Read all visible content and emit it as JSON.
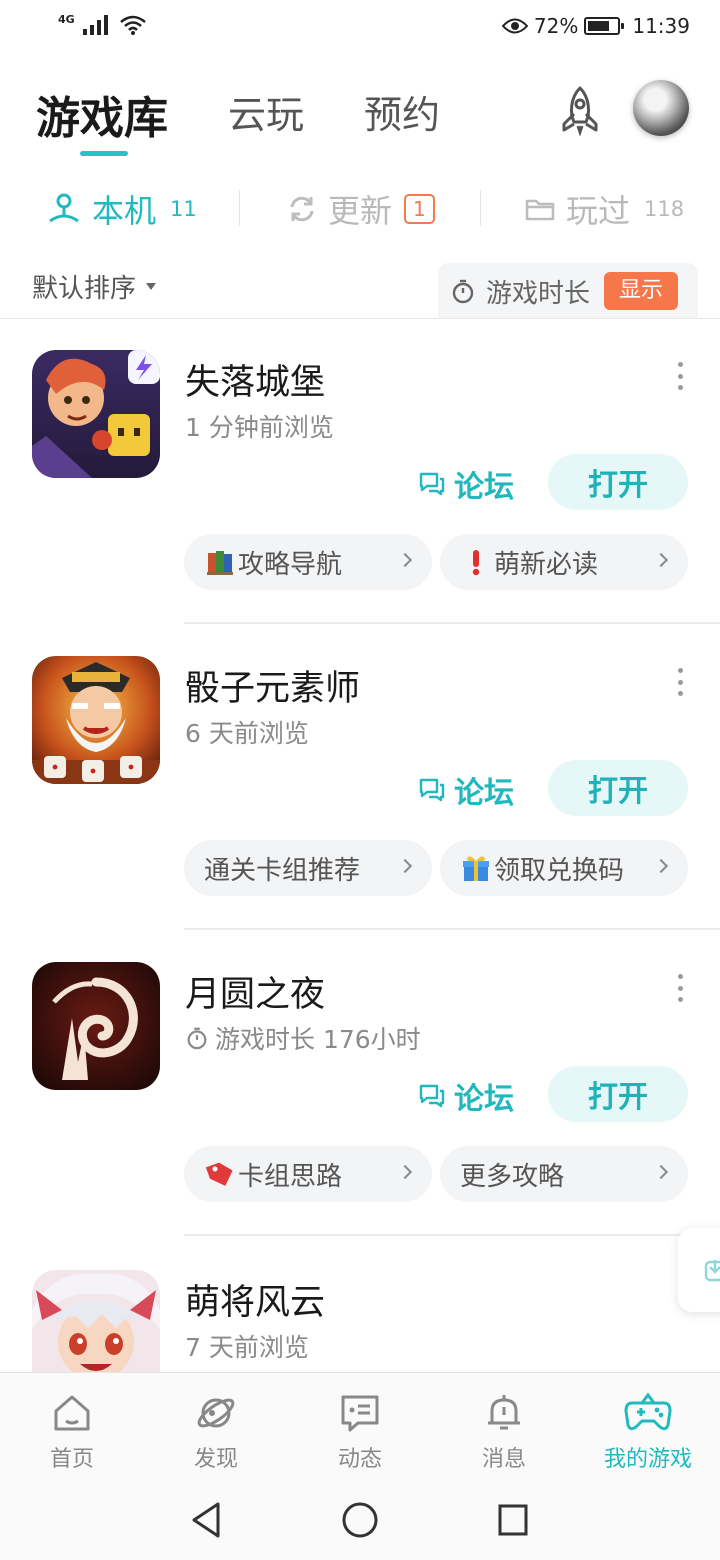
{
  "status_bar": {
    "network": "4G",
    "battery_percent": "72%",
    "battery_level": 0.72,
    "time": "11:39"
  },
  "header": {
    "tabs": [
      {
        "label": "游戏库",
        "active": true
      },
      {
        "label": "云玩",
        "active": false
      },
      {
        "label": "预约",
        "active": false
      }
    ],
    "icons": [
      "rocket-icon",
      "avatar"
    ]
  },
  "subtabs": [
    {
      "label": "本机",
      "count": "11",
      "icon": "local-device-icon",
      "active": true
    },
    {
      "label": "更新",
      "count": "1",
      "icon": "refresh-icon",
      "active": false
    },
    {
      "label": "玩过",
      "count": "118",
      "icon": "folder-icon",
      "active": false
    }
  ],
  "toolbar": {
    "sort_label": "默认排序",
    "playtime_label": "游戏时长",
    "show_button": "显示"
  },
  "games": [
    {
      "name": "失落城堡",
      "subtitle": "1 分钟前浏览",
      "forum_label": "论坛",
      "open_label": "打开",
      "chips": [
        {
          "icon": "book-icon",
          "label": "攻略导航"
        },
        {
          "icon": "exclamation-icon",
          "label": "萌新必读"
        }
      ]
    },
    {
      "name": "骰子元素师",
      "subtitle": "6 天前浏览",
      "forum_label": "论坛",
      "open_label": "打开",
      "chips": [
        {
          "icon": "",
          "label": "通关卡组推荐"
        },
        {
          "icon": "gift-icon",
          "label": "领取兑换码"
        }
      ]
    },
    {
      "name": "月圆之夜",
      "subtitle": "游戏时长 176小时",
      "forum_label": "论坛",
      "open_label": "打开",
      "chips": [
        {
          "icon": "tag-icon",
          "label": "卡组思路"
        },
        {
          "icon": "",
          "label": "更多攻略"
        }
      ]
    },
    {
      "name": "萌将风云",
      "subtitle": "7 天前浏览"
    }
  ],
  "bottom_nav": [
    {
      "label": "首页",
      "icon": "home-icon",
      "active": false
    },
    {
      "label": "发现",
      "icon": "planet-icon",
      "active": false
    },
    {
      "label": "动态",
      "icon": "message-icon",
      "active": false
    },
    {
      "label": "消息",
      "icon": "bell-icon",
      "active": false
    },
    {
      "label": "我的游戏",
      "icon": "gamepad-icon",
      "active": true
    }
  ],
  "colors": {
    "accent": "#22b9bf",
    "badge": "#f07b4d",
    "show_button": "#f6774a"
  }
}
